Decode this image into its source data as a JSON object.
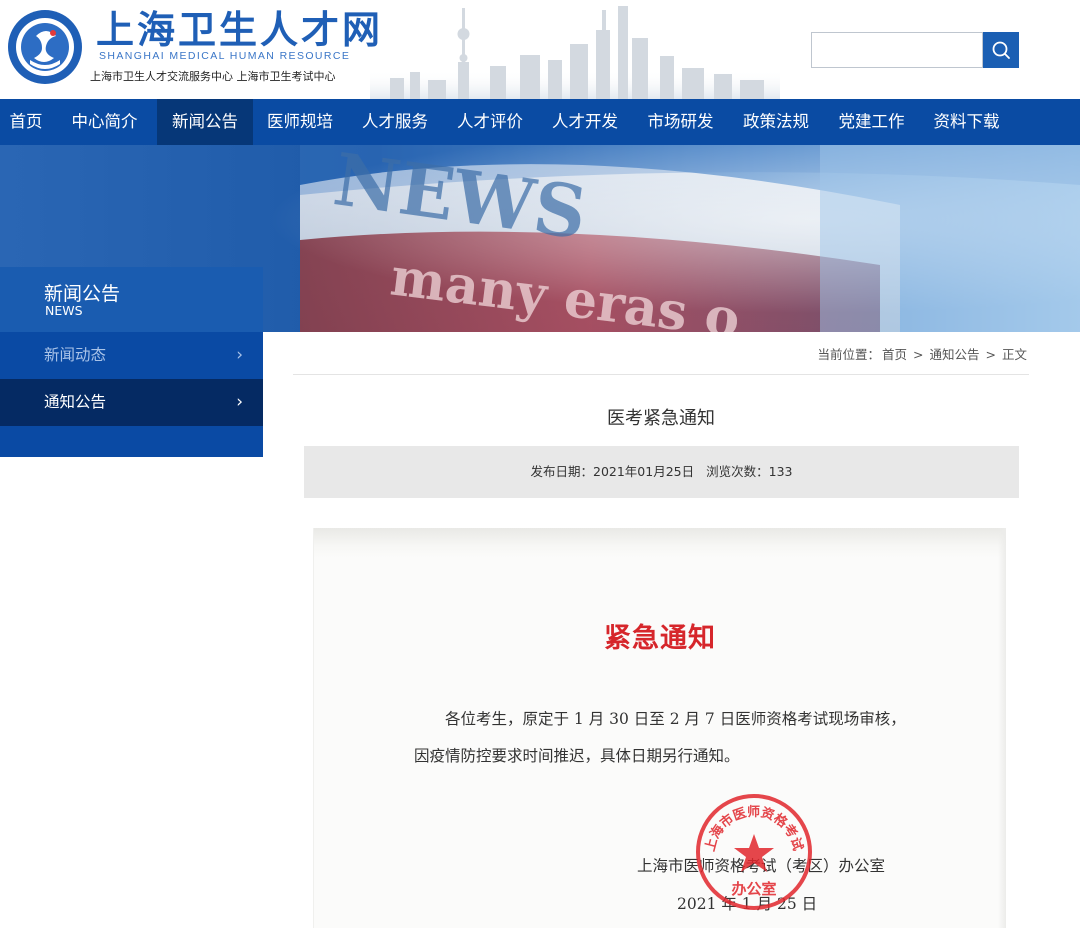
{
  "header": {
    "site_title": "上海卫生人才网",
    "site_subtitle_en": "SHANGHAI MEDICAL HUMAN RESOURCE",
    "site_subtitle_cn": "上海市卫生人才交流服务中心  上海市卫生考试中心",
    "search": {
      "value": "",
      "placeholder": "",
      "button_icon": "search-icon"
    }
  },
  "nav": {
    "items": [
      {
        "label": "首页"
      },
      {
        "label": "中心简介"
      },
      {
        "label": "新闻公告",
        "active": true
      },
      {
        "label": "医师规培"
      },
      {
        "label": "人才服务"
      },
      {
        "label": "人才评价"
      },
      {
        "label": "人才开发"
      },
      {
        "label": "市场研发"
      },
      {
        "label": "政策法规"
      },
      {
        "label": "党建工作"
      },
      {
        "label": "资料下载"
      }
    ]
  },
  "banner": {
    "word1": "NEWS",
    "word2": "many eras o"
  },
  "sidebar": {
    "title": "新闻公告",
    "title_en": "NEWS",
    "items": [
      {
        "label": "新闻动态",
        "chevron": "›"
      },
      {
        "label": "通知公告",
        "chevron": "›",
        "active": true
      }
    ]
  },
  "breadcrumb": {
    "prefix": "当前位置：",
    "home": "首页",
    "sep": ">",
    "section": "通知公告",
    "current": "正文"
  },
  "article": {
    "title": "医考紧急通知",
    "date_label": "发布日期：2021年01月25日",
    "views_label": "浏览次数：133"
  },
  "notice": {
    "heading": "紧急通知",
    "line1": "各位考生，原定于 1 月 30 日至 2 月 7 日医师资格考试现场审核，",
    "line2": "因疫情防控要求时间推迟，具体日期另行通知。",
    "signature": "上海市医师资格考试（考区）办公室",
    "date": "2021 年 1 月 25 日",
    "seal_text": "上海市医师资格考试（考区）",
    "seal_bottom": "办公室"
  },
  "colors": {
    "nav_bg": "#0a4ba3",
    "nav_active": "#063778",
    "brand": "#1f5fb6",
    "notice_red": "#d6262b"
  }
}
